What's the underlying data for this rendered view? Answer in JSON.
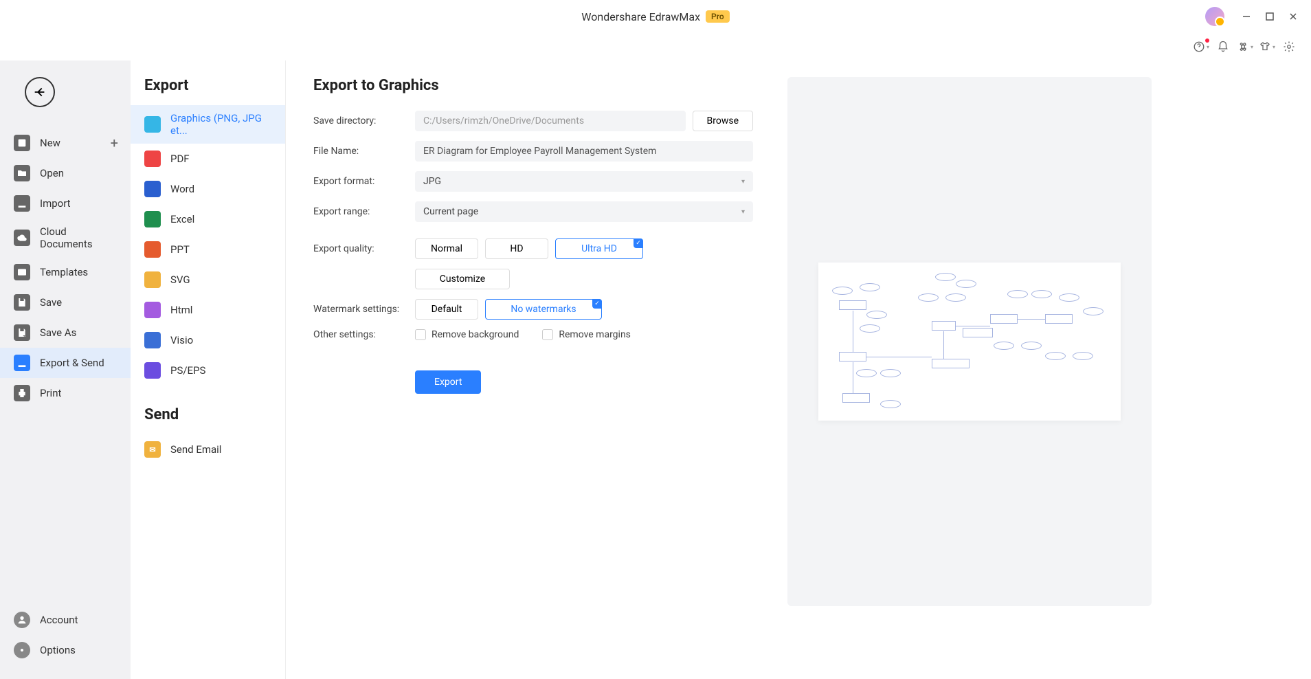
{
  "titlebar": {
    "title": "Wondershare EdrawMax",
    "badge": "Pro"
  },
  "leftNav": {
    "items": [
      {
        "key": "new",
        "label": "New",
        "plus": true
      },
      {
        "key": "open",
        "label": "Open"
      },
      {
        "key": "import",
        "label": "Import"
      },
      {
        "key": "cloud",
        "label": "Cloud Documents"
      },
      {
        "key": "templates",
        "label": "Templates"
      },
      {
        "key": "save",
        "label": "Save"
      },
      {
        "key": "saveas",
        "label": "Save As"
      },
      {
        "key": "export",
        "label": "Export & Send",
        "active": true
      },
      {
        "key": "print",
        "label": "Print"
      }
    ],
    "bottom": [
      {
        "key": "account",
        "label": "Account"
      },
      {
        "key": "options",
        "label": "Options"
      }
    ]
  },
  "midPanel": {
    "exportTitle": "Export",
    "exportItems": [
      {
        "key": "graphics",
        "label": "Graphics (PNG, JPG et...",
        "color": "#35b6e6",
        "active": true
      },
      {
        "key": "pdf",
        "label": "PDF",
        "color": "#e44"
      },
      {
        "key": "word",
        "label": "Word",
        "color": "#2a5fcf"
      },
      {
        "key": "excel",
        "label": "Excel",
        "color": "#1f8f4e"
      },
      {
        "key": "ppt",
        "label": "PPT",
        "color": "#e55b2e"
      },
      {
        "key": "svg",
        "label": "SVG",
        "color": "#f0b23e"
      },
      {
        "key": "html",
        "label": "Html",
        "color": "#a45be0"
      },
      {
        "key": "visio",
        "label": "Visio",
        "color": "#3a6fd6"
      },
      {
        "key": "pseps",
        "label": "PS/EPS",
        "color": "#6b4de0"
      }
    ],
    "sendTitle": "Send",
    "sendItems": [
      {
        "key": "email",
        "label": "Send Email",
        "color": "#f0b23e"
      }
    ]
  },
  "form": {
    "title": "Export to Graphics",
    "saveDirLabel": "Save directory:",
    "saveDirValue": "C:/Users/rimzh/OneDrive/Documents",
    "browseLabel": "Browse",
    "fileNameLabel": "File Name:",
    "fileNameValue": "ER Diagram for Employee Payroll Management System",
    "formatLabel": "Export format:",
    "formatValue": "JPG",
    "rangeLabel": "Export range:",
    "rangeValue": "Current page",
    "qualityLabel": "Export quality:",
    "qualityNormal": "Normal",
    "qualityHD": "HD",
    "qualityUltra": "Ultra HD",
    "customize": "Customize",
    "watermarkLabel": "Watermark settings:",
    "watermarkDefault": "Default",
    "watermarkNone": "No watermarks",
    "otherLabel": "Other settings:",
    "removeBg": "Remove background",
    "removeMargins": "Remove margins",
    "exportBtn": "Export"
  }
}
